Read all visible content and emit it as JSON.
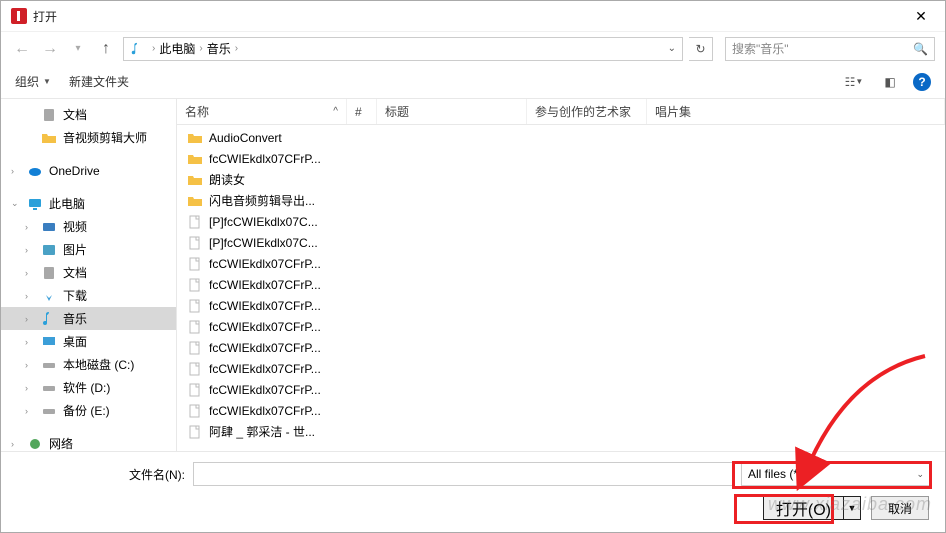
{
  "title": "打开",
  "breadcrumb": {
    "root": "此电脑",
    "folder": "音乐"
  },
  "search_placeholder": "搜索\"音乐\"",
  "toolbar": {
    "organize": "组织",
    "newfolder": "新建文件夹"
  },
  "sidebar": {
    "docs": "文档",
    "audioeditor": "音视频剪辑大师",
    "onedrive": "OneDrive",
    "thispc": "此电脑",
    "video": "视频",
    "pictures": "图片",
    "documents": "文档",
    "downloads": "下载",
    "music": "音乐",
    "desktop": "桌面",
    "cdrive": "本地磁盘 (C:)",
    "ddrive": "软件 (D:)",
    "edrive": "备份 (E:)",
    "network": "网络"
  },
  "columns": {
    "name": "名称",
    "num": "#",
    "title": "标题",
    "artist": "参与创作的艺术家",
    "album": "唱片集"
  },
  "files": [
    {
      "type": "folder",
      "name": "AudioConvert"
    },
    {
      "type": "folder",
      "name": "fcCWIEkdlx07CFrP..."
    },
    {
      "type": "folder",
      "name": "朗读女"
    },
    {
      "type": "folder",
      "name": "闪电音频剪辑导出..."
    },
    {
      "type": "file",
      "name": "[P]fcCWIEkdlx07C..."
    },
    {
      "type": "file",
      "name": "[P]fcCWIEkdlx07C..."
    },
    {
      "type": "file",
      "name": "fcCWIEkdlx07CFrP..."
    },
    {
      "type": "file",
      "name": "fcCWIEkdlx07CFrP..."
    },
    {
      "type": "file",
      "name": "fcCWIEkdlx07CFrP..."
    },
    {
      "type": "file",
      "name": "fcCWIEkdlx07CFrP..."
    },
    {
      "type": "file",
      "name": "fcCWIEkdlx07CFrP..."
    },
    {
      "type": "file",
      "name": "fcCWIEkdlx07CFrP..."
    },
    {
      "type": "file",
      "name": "fcCWIEkdlx07CFrP..."
    },
    {
      "type": "file",
      "name": "fcCWIEkdlx07CFrP..."
    },
    {
      "type": "file",
      "name": "阿肆 _ 郭采洁 - 世..."
    }
  ],
  "filename_label": "文件名(N):",
  "filter": "All files (*.*)",
  "buttons": {
    "open": "打开(O)",
    "cancel": "取消"
  },
  "watermark": "www.xiazaiba.com"
}
